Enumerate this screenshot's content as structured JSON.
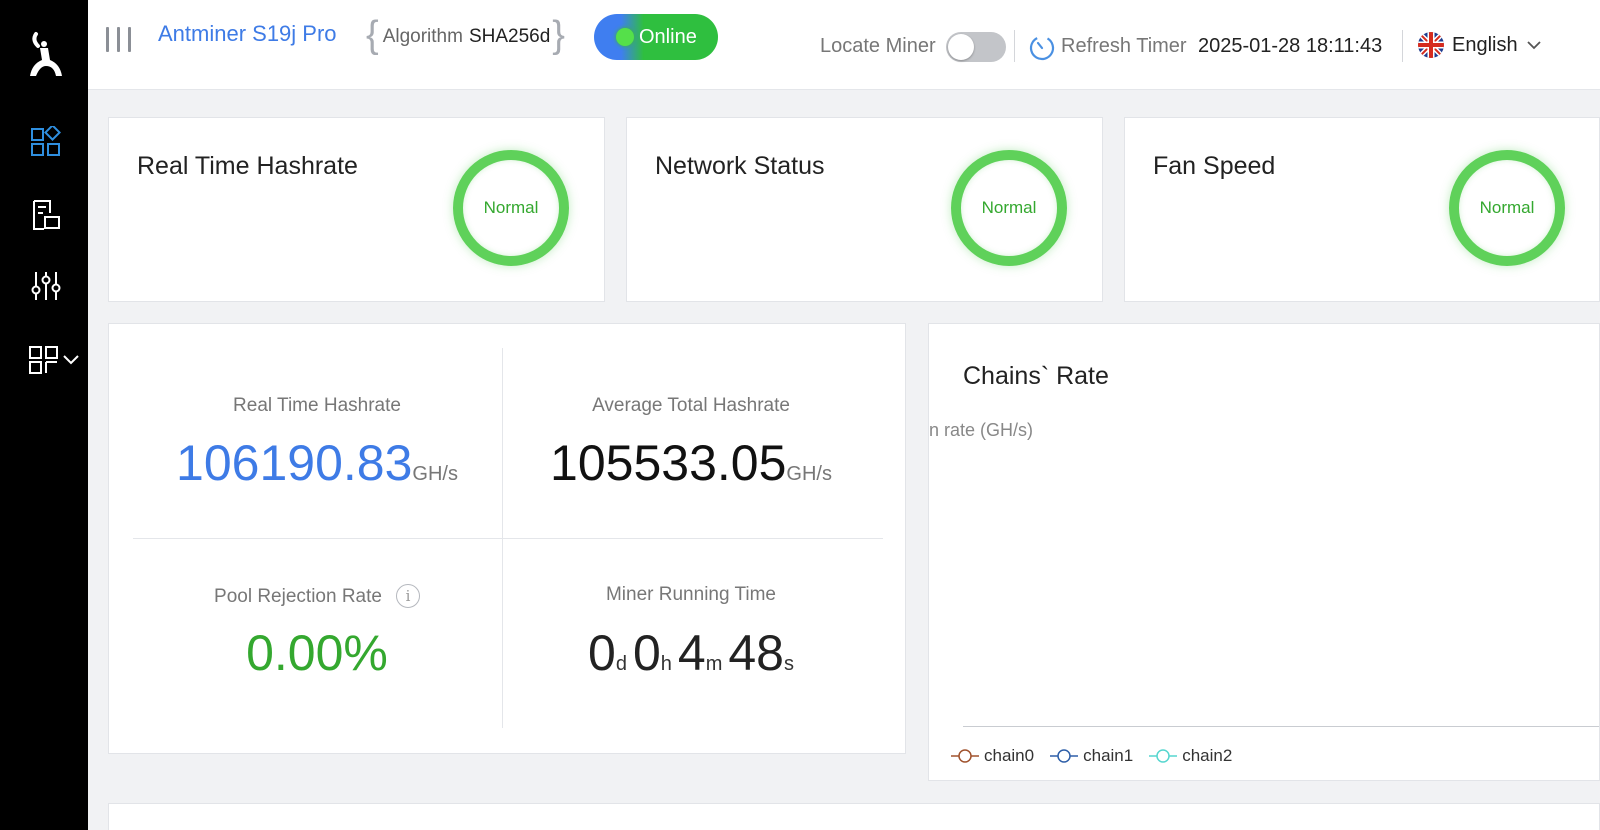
{
  "header": {
    "model": "Antminer S19j Pro",
    "algorithm_label": "Algorithm",
    "algorithm_value": "SHA256d",
    "status": "Online",
    "locate_label": "Locate Miner",
    "locate_enabled": false,
    "refresh_label": "Refresh Timer",
    "refresh_time": "2025-01-28 18:11:43",
    "language": "English"
  },
  "sidebar": {
    "items": [
      {
        "icon": "dashboard-icon"
      },
      {
        "icon": "miner-status-icon"
      },
      {
        "icon": "settings-sliders-icon"
      },
      {
        "icon": "system-modules-icon"
      }
    ]
  },
  "status_cards": [
    {
      "title": "Real Time Hashrate",
      "status": "Normal"
    },
    {
      "title": "Network Status",
      "status": "Normal"
    },
    {
      "title": "Fan Speed",
      "status": "Normal"
    }
  ],
  "stats": {
    "realtime_label": "Real Time Hashrate",
    "realtime_value": "106190.83",
    "realtime_unit": "GH/s",
    "average_label": "Average Total Hashrate",
    "average_value": "105533.05",
    "average_unit": "GH/s",
    "rejection_label": "Pool Rejection Rate",
    "rejection_value": "0.00%",
    "info_glyph": "i",
    "runtime_label": "Miner Running Time",
    "runtime": {
      "d": "0",
      "d_unit": "d",
      "h": "0",
      "h_unit": "h",
      "m": "4",
      "m_unit": "m",
      "s": "48",
      "s_unit": "s"
    }
  },
  "chains": {
    "title": "Chains` Rate",
    "axis_label": "n rate (GH/s)",
    "legend": [
      {
        "name": "chain0",
        "color": "#a0522d"
      },
      {
        "name": "chain1",
        "color": "#2e5fa8"
      },
      {
        "name": "chain2",
        "color": "#57d6cf"
      }
    ]
  },
  "colors": {
    "accent_blue": "#3e7be6",
    "ok_green": "#34a82f",
    "sidebar_icon": "#2f8fe0"
  }
}
